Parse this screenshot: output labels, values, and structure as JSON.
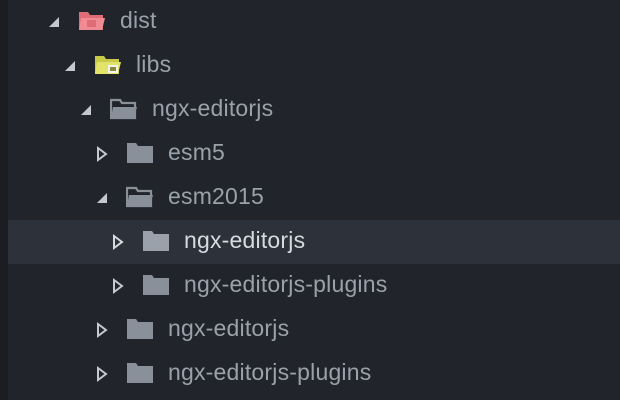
{
  "tree": {
    "items": [
      {
        "label": "dist",
        "expanded": true,
        "icon": "folder-open-dist-icon",
        "color": "#e06c75"
      },
      {
        "label": "libs",
        "expanded": true,
        "icon": "folder-lib-icon",
        "color": "#d4d45a"
      },
      {
        "label": "ngx-editorjs",
        "expanded": true,
        "icon": "folder-open-icon",
        "color": "#8a9099"
      },
      {
        "label": "esm5",
        "expanded": false,
        "icon": "folder-icon",
        "color": "#8a9099"
      },
      {
        "label": "esm2015",
        "expanded": true,
        "icon": "folder-open-icon",
        "color": "#8a9099"
      },
      {
        "label": "ngx-editorjs",
        "expanded": false,
        "icon": "folder-icon",
        "color": "#8a9099",
        "selected": true
      },
      {
        "label": "ngx-editorjs-plugins",
        "expanded": false,
        "icon": "folder-icon",
        "color": "#8a9099"
      },
      {
        "label": "ngx-editorjs",
        "expanded": false,
        "icon": "folder-icon",
        "color": "#8a9099"
      },
      {
        "label": "ngx-editorjs-plugins",
        "expanded": false,
        "icon": "folder-icon",
        "color": "#8a9099"
      }
    ]
  }
}
